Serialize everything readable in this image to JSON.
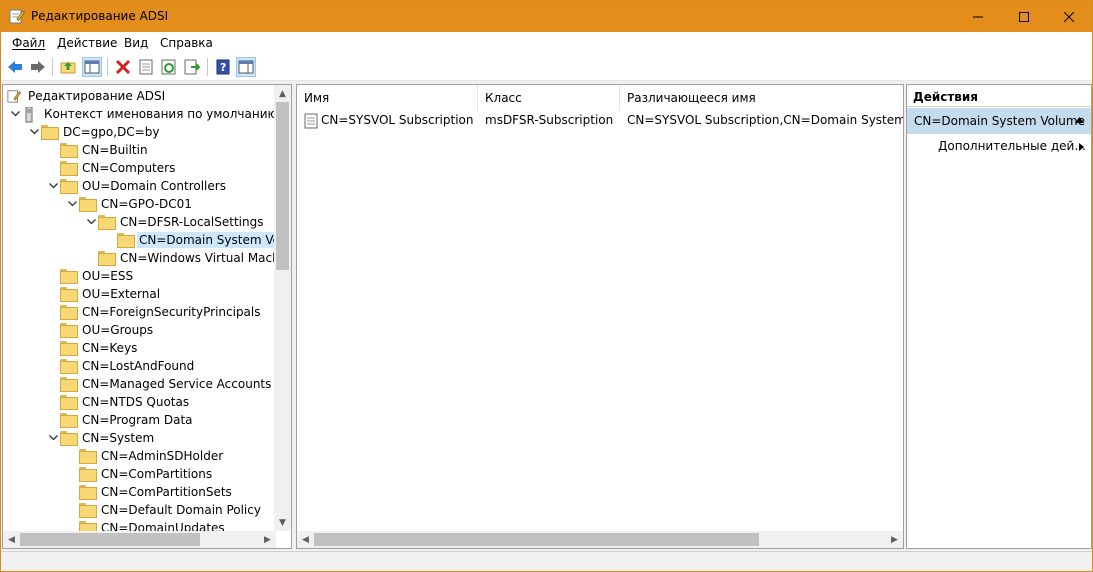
{
  "window": {
    "title": "Редактирование ADSI",
    "minimize": "─",
    "maximize": "☐",
    "close": "✕"
  },
  "menu": [
    "Файл",
    "Действие",
    "Вид",
    "Справка"
  ],
  "tree": {
    "root": "Редактирование ADSI",
    "items": [
      {
        "label": "Контекст именования по умолчанию [GP",
        "expanded": true
      },
      {
        "label": "DC=gpo,DC=by",
        "expanded": true
      },
      {
        "label": "CN=Builtin"
      },
      {
        "label": "CN=Computers"
      },
      {
        "label": "OU=Domain Controllers",
        "expanded": true
      },
      {
        "label": "CN=GPO-DC01",
        "expanded": true
      },
      {
        "label": "CN=DFSR-LocalSettings",
        "expanded": true
      },
      {
        "label": "CN=Domain System Volu",
        "selected": true
      },
      {
        "label": "CN=Windows Virtual Machir"
      },
      {
        "label": "OU=ESS"
      },
      {
        "label": "OU=External"
      },
      {
        "label": "CN=ForeignSecurityPrincipals"
      },
      {
        "label": "OU=Groups"
      },
      {
        "label": "CN=Keys"
      },
      {
        "label": "CN=LostAndFound"
      },
      {
        "label": "CN=Managed Service Accounts"
      },
      {
        "label": "CN=NTDS Quotas"
      },
      {
        "label": "CN=Program Data"
      },
      {
        "label": "CN=System",
        "expanded": true
      },
      {
        "label": "CN=AdminSDHolder"
      },
      {
        "label": "CN=ComPartitions"
      },
      {
        "label": "CN=ComPartitionSets"
      },
      {
        "label": "CN=Default Domain Policy"
      },
      {
        "label": "CN=DomainUpdates"
      }
    ]
  },
  "list": {
    "columns": [
      "Имя",
      "Класс",
      "Различающееся имя"
    ],
    "rows": [
      {
        "name": "CN=SYSVOL Subscription",
        "class": "msDFSR-Subscription",
        "dn": "CN=SYSVOL Subscription,CN=Domain System Volu"
      }
    ]
  },
  "actions": {
    "header": "Действия",
    "section": "CN=Domain System Volume",
    "item": "Дополнительные дей..."
  },
  "colors": {
    "titlebar": "#e38d1a",
    "selection": "#cce8ff",
    "actions_section": "#c5dbee"
  }
}
